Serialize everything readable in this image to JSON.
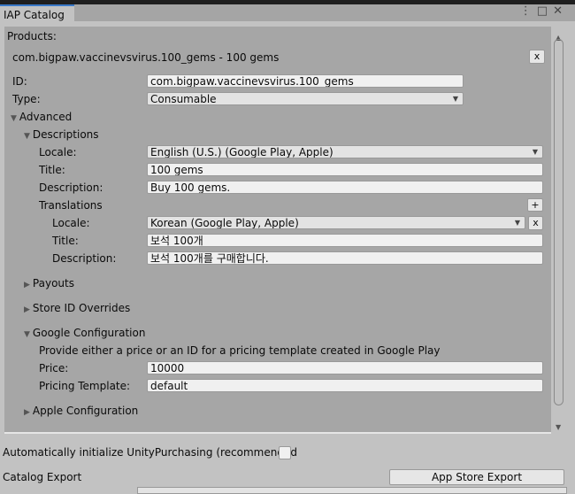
{
  "window": {
    "tab_title": "IAP Catalog",
    "icons": [
      "more-vertical-icon",
      "maximize-icon",
      "close-icon"
    ]
  },
  "products_label": "Products:",
  "product": {
    "header": "com.bigpaw.vaccinevsvirus.100_gems - 100 gems",
    "remove_label": "x",
    "id_label": "ID:",
    "id_value": "com.bigpaw.vaccinevsvirus.100_gems",
    "type_label": "Type:",
    "type_value": "Consumable",
    "advanced_label": "Advanced",
    "descriptions_label": "Descriptions",
    "locale_label": "Locale:",
    "locale_value": "English (U.S.) (Google Play, Apple)",
    "title_label": "Title:",
    "title_value": "100 gems",
    "description_label": "Description:",
    "description_value": "Buy 100 gems.",
    "translations_label": "Translations",
    "add_label": "+",
    "tr_locale_label": "Locale:",
    "tr_locale_value": "Korean (Google Play, Apple)",
    "tr_remove_label": "x",
    "tr_title_label": "Title:",
    "tr_title_value": "보석 100개",
    "tr_description_label": "Description:",
    "tr_description_value": "보석 100개를 구매합니다.",
    "payouts_label": "Payouts",
    "store_id_label": "Store ID Overrides",
    "google_label": "Google Configuration",
    "google_hint": "Provide either a price or an ID for a pricing template created in Google Play",
    "price_label": "Price:",
    "price_value": "10000",
    "pricing_template_label": "Pricing Template:",
    "pricing_template_value": "default",
    "apple_label": "Apple Configuration"
  },
  "auto_init_label": "Automatically initialize UnityPurchasing (recommended",
  "catalog_export_label": "Catalog Export",
  "app_store_export_label": "App Store Export"
}
